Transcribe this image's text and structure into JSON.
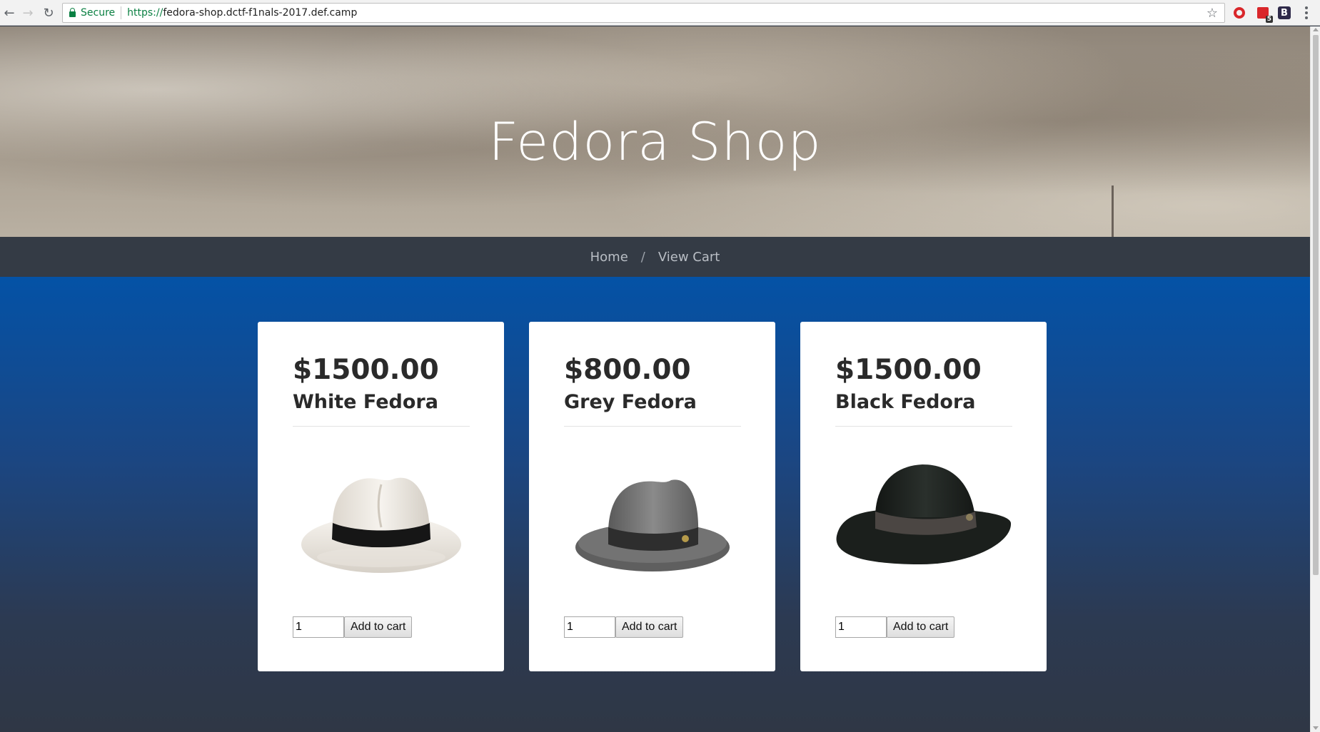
{
  "browser": {
    "secure_label": "Secure",
    "url_scheme": "https://",
    "url_host": "fedora-shop.dctf-f1nals-2017.def.camp",
    "icons": [
      "back-icon",
      "forward-icon",
      "reload-icon",
      "lock-icon",
      "star-icon",
      "opera-icon",
      "pdf-extension-icon",
      "bootstrap-extension-icon",
      "menu-icon"
    ],
    "pdf_badge": "5",
    "bootstrap_letter": "B"
  },
  "header": {
    "title": "Fedora Shop"
  },
  "nav": {
    "home": "Home",
    "divider": "/",
    "view_cart": "View Cart"
  },
  "colors": {
    "nav_bg": "#343b45",
    "main_top": "#0452a6",
    "main_bottom": "#2f3745"
  },
  "products": [
    {
      "price": "$1500.00",
      "name": "White Fedora",
      "qty": "1",
      "add_label": "Add to cart",
      "hat_color": "#ebe6df",
      "band_color": "#1a1a1a"
    },
    {
      "price": "$800.00",
      "name": "Grey Fedora",
      "qty": "1",
      "add_label": "Add to cart",
      "hat_color": "#6f6f6f",
      "band_color": "#333333"
    },
    {
      "price": "$1500.00",
      "name": "Black Fedora",
      "qty": "1",
      "add_label": "Add to cart",
      "hat_color": "#1d221f",
      "band_color": "#4a4643"
    }
  ]
}
